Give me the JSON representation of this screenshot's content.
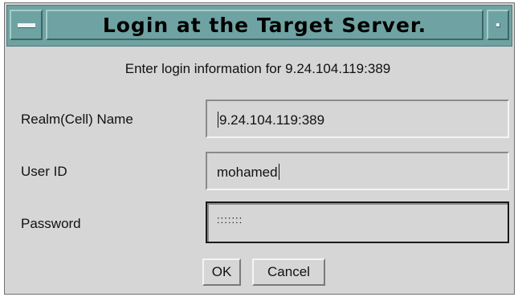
{
  "window": {
    "title": "Login at the Target Server."
  },
  "dialog": {
    "prompt": "Enter login information for 9.24.104.119:389",
    "fields": {
      "realm": {
        "label": "Realm(Cell) Name",
        "value": "9.24.104.119:389"
      },
      "user_id": {
        "label": "User ID",
        "value": "mohamed"
      },
      "password": {
        "label": "Password",
        "value": ":::::::"
      }
    },
    "buttons": {
      "ok": "OK",
      "cancel": "Cancel"
    }
  },
  "icons": {
    "window_menu": "window-menu-icon",
    "minimize": "minimize-icon"
  },
  "colors": {
    "titlebar": "#6fa3a3",
    "dialog_bg": "#d6d6d6"
  }
}
